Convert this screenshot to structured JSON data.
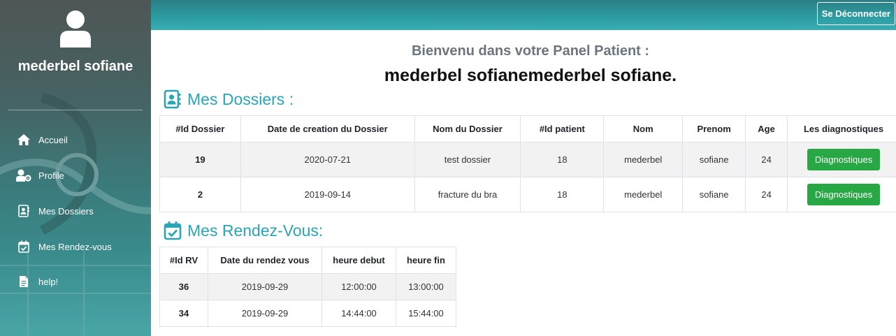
{
  "sidebar": {
    "user_name": "mederbel sofiane",
    "items": [
      {
        "label": "Accueil",
        "icon": "home-icon"
      },
      {
        "label": "Profile",
        "icon": "user-cog-icon"
      },
      {
        "label": "Mes Dossiers",
        "icon": "contact-book-icon"
      },
      {
        "label": "Mes Rendez-vous",
        "icon": "calendar-check-icon"
      },
      {
        "label": "help!",
        "icon": "file-icon"
      }
    ]
  },
  "header": {
    "logout_label": "Se Déconnecter"
  },
  "main": {
    "welcome_subtitle": "Bienvenu dans votre Panel Patient :",
    "welcome_name": "mederbel sofianemederbel sofiane.",
    "dossiers": {
      "title": "Mes Dossiers :",
      "columns": [
        "#Id Dossier",
        "Date de creation du Dossier",
        "Nom du Dossier",
        "#Id patient",
        "Nom",
        "Prenom",
        "Age",
        "Les diagnostiques"
      ],
      "rows": [
        {
          "id": "19",
          "date": "2020-07-21",
          "nom_dossier": "test dossier",
          "id_patient": "18",
          "nom": "mederbel",
          "prenom": "sofiane",
          "age": "24",
          "action": "Diagnostiques"
        },
        {
          "id": "2",
          "date": "2019-09-14",
          "nom_dossier": "fracture du bra",
          "id_patient": "18",
          "nom": "mederbel",
          "prenom": "sofiane",
          "age": "24",
          "action": "Diagnostiques"
        }
      ]
    },
    "rendezvous": {
      "title": "Mes Rendez-Vous:",
      "columns": [
        "#Id RV",
        "Date du rendez vous",
        "heure debut",
        "heure fin"
      ],
      "rows": [
        {
          "id": "36",
          "date": "2019-09-29",
          "debut": "12:00:00",
          "fin": "13:00:00"
        },
        {
          "id": "34",
          "date": "2019-09-29",
          "debut": "14:44:00",
          "fin": "15:44:00"
        }
      ]
    }
  },
  "colors": {
    "accent": "#2aa5b4",
    "button_green": "#28a745",
    "topbar": "#2d9ea3"
  }
}
